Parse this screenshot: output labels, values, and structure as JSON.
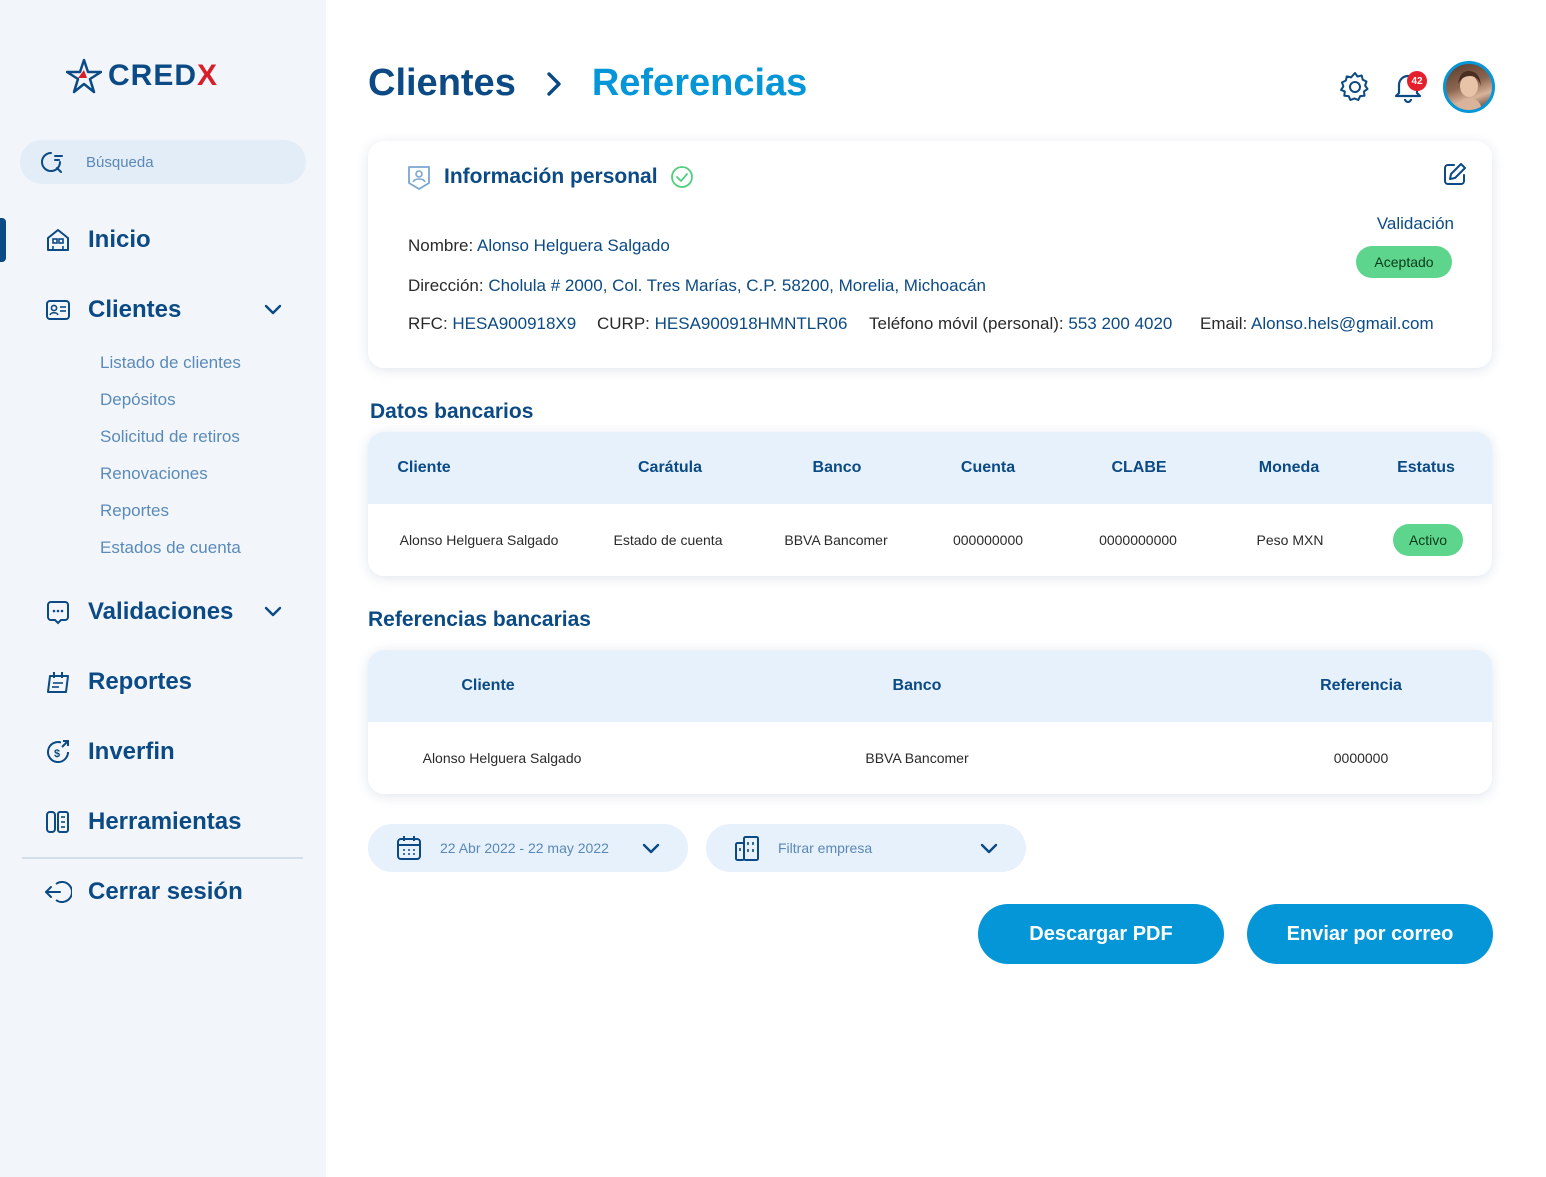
{
  "brand": {
    "name_main": "CRED",
    "name_accent": "X",
    "accent_color": "#d71f2b",
    "primary_color": "#0b4a84",
    "secondary_color": "#0596d8"
  },
  "search": {
    "placeholder": "Búsqueda"
  },
  "sidebar": {
    "items": [
      {
        "label": "Inicio",
        "icon": "home-icon"
      },
      {
        "label": "Clientes",
        "icon": "id-card-icon"
      },
      {
        "label": "Validaciones",
        "icon": "validation-icon"
      },
      {
        "label": "Reportes",
        "icon": "report-icon"
      },
      {
        "label": "Inverfin",
        "icon": "money-icon"
      },
      {
        "label": "Herramientas",
        "icon": "tools-icon"
      },
      {
        "label": "Cerrar sesión",
        "icon": "logout-icon"
      }
    ],
    "clientes_sub": [
      "Listado de clientes",
      "Depósitos",
      "Solicitud de retiros",
      "Renovaciones",
      "Reportes",
      "Estados de cuenta"
    ]
  },
  "header": {
    "crumb_parent": "Clientes",
    "crumb_current": "Referencias",
    "notifications_count": "42"
  },
  "personal_info": {
    "title": "Información personal",
    "validation_label": "Validación",
    "validation_status": "Aceptado",
    "nombre_label": "Nombre:",
    "nombre": "Alonso Helguera Salgado",
    "direccion_label": "Dirección:",
    "direccion": "Cholula # 2000, Col. Tres Marías, C.P. 58200, Morelia, Michoacán",
    "rfc_label": "RFC:",
    "rfc": "HESA900918X9",
    "curp_label": "CURP:",
    "curp": "HESA900918HMNTLR06",
    "telefono_label": "Teléfono móvil (personal):",
    "telefono": "553 200 4020",
    "email_label": "Email:",
    "email": "Alonso.hels@gmail.com"
  },
  "datos_bancarios": {
    "title": "Datos bancarios",
    "columns": [
      "Cliente",
      "Carátula",
      "Banco",
      "Cuenta",
      "CLABE",
      "Moneda",
      "Estatus"
    ],
    "rows": [
      [
        "Alonso Helguera Salgado",
        "Estado de cuenta",
        "BBVA Bancomer",
        "000000000",
        "0000000000",
        "Peso MXN",
        "Activo"
      ]
    ]
  },
  "referencias_bancarias": {
    "title": "Referencias bancarias",
    "columns": [
      "Cliente",
      "Banco",
      "Referencia"
    ],
    "rows": [
      [
        "Alonso Helguera Salgado",
        "BBVA Bancomer",
        "0000000"
      ]
    ]
  },
  "filters": {
    "date_range": "22 Abr 2022 - 22 may 2022",
    "company_placeholder": "Filtrar empresa"
  },
  "actions": {
    "download_pdf": "Descargar PDF",
    "send_email": "Enviar por correo"
  }
}
